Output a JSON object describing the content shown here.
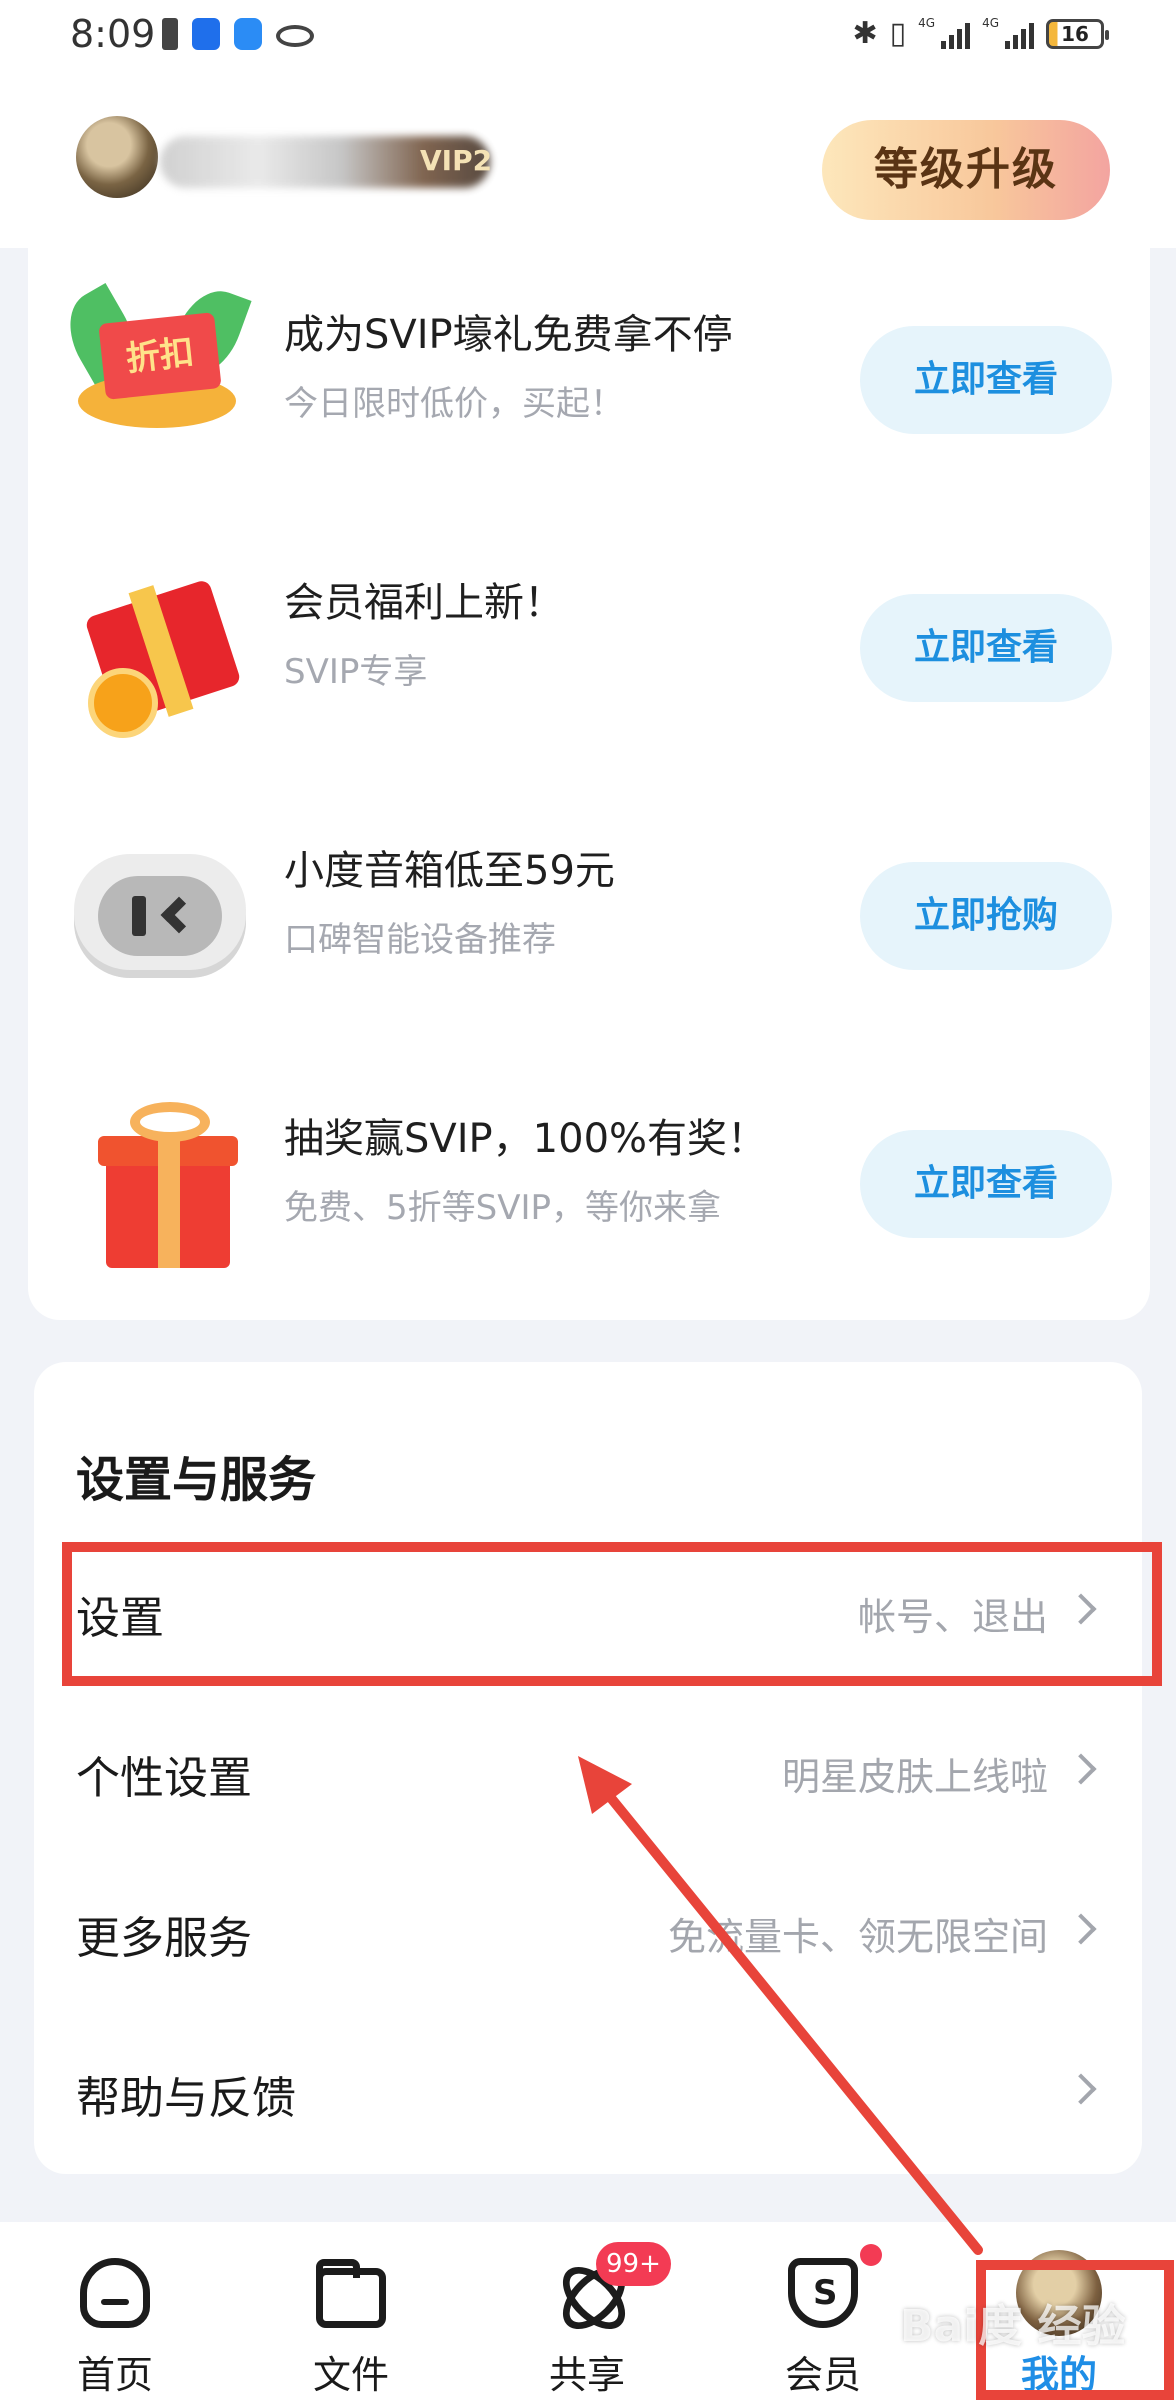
{
  "status_bar": {
    "time": "8:09",
    "battery": "16"
  },
  "profile": {
    "vip_tag": "VIP2",
    "upgrade_label": "等级升级"
  },
  "promos": [
    {
      "icon": "discount-icon",
      "title": "成为SVIP壕礼免费拿不停",
      "subtitle": "今日限时低价，买起！",
      "button": "立即查看",
      "tag_text": "折扣"
    },
    {
      "icon": "gift-box-icon",
      "title": "会员福利上新！",
      "subtitle": "SVIP专享",
      "button": "立即查看"
    },
    {
      "icon": "smart-speaker-icon",
      "title": "小度音箱低至59元",
      "subtitle": "口碑智能设备推荐",
      "button": "立即抢购"
    },
    {
      "icon": "gift-icon",
      "title": "抽奖赢SVIP，100%有奖！",
      "subtitle": "免费、5折等SVIP，等你来拿",
      "button": "立即查看"
    }
  ],
  "settings": {
    "title": "设置与服务",
    "rows": [
      {
        "label": "设置",
        "hint": "帐号、退出"
      },
      {
        "label": "个性设置",
        "hint": "明星皮肤上线啦"
      },
      {
        "label": "更多服务",
        "hint": "免流量卡、领无限空间"
      },
      {
        "label": "帮助与反馈",
        "hint": ""
      }
    ]
  },
  "bottom_nav": [
    {
      "label": "首页",
      "icon": "home-cloud-icon"
    },
    {
      "label": "文件",
      "icon": "folder-icon"
    },
    {
      "label": "共享",
      "icon": "atom-icon",
      "badge": "99+"
    },
    {
      "label": "会员",
      "icon": "diamond-icon",
      "icon_letter": "S"
    },
    {
      "label": "我的",
      "icon": "avatar-icon",
      "active": true
    }
  ],
  "watermark": "Bai度 经验",
  "colors": {
    "accent": "#1f8ee6",
    "annotation": "#e8443a",
    "badge": "#f33b54"
  }
}
